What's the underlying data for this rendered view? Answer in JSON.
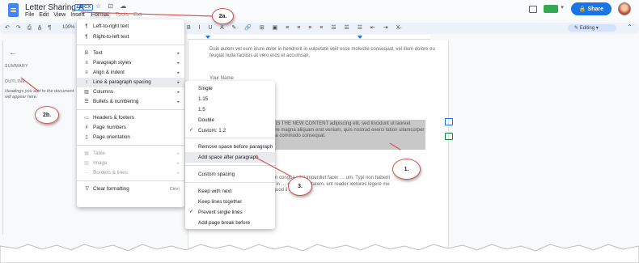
{
  "doc": {
    "title": "Letter Sharing-A",
    "badge": "DOCX",
    "title_icons": "☆ ⊡ ☁"
  },
  "menubar": {
    "items": [
      "File",
      "Edit",
      "View",
      "Insert",
      "Format",
      "Tools",
      "Ext"
    ]
  },
  "share": {
    "label": "Share",
    "icon": "lock-icon"
  },
  "toolbar": {
    "left_icons": "↶ ↷ ⎙ A̲ ¶",
    "zoom": "100%",
    "right_icons": "B I U A ✎ 🔗 ⊞ ▣ ≡ ≡ ≡ ≡ ☰ ☰ ☰ ⇤ ⇥ X̶",
    "editing_label": "Editing"
  },
  "left_panel": {
    "summary": "SUMMARY",
    "outline": "OUTLINE",
    "outline_hint": "Headings you add to the document will appear here."
  },
  "format_menu": {
    "items": [
      {
        "icon": "¶",
        "label": "Left-to-right text",
        "arrow": ""
      },
      {
        "icon": "¶",
        "label": "Right-to-left text",
        "arrow": ""
      },
      {
        "icon": "B",
        "label": "Text",
        "arrow": "▸"
      },
      {
        "icon": "≡",
        "label": "Paragraph styles",
        "arrow": "▸"
      },
      {
        "icon": "≡",
        "label": "Align & indent",
        "arrow": "▸"
      },
      {
        "icon": "↕",
        "label": "Line & paragraph spacing",
        "arrow": "▸"
      },
      {
        "icon": "▥",
        "label": "Columns",
        "arrow": "▸"
      },
      {
        "icon": "☰",
        "label": "Bullets & numbering",
        "arrow": "▸"
      },
      {
        "icon": "▭",
        "label": "Headers & footers",
        "arrow": ""
      },
      {
        "icon": "#",
        "label": "Page numbers",
        "arrow": ""
      },
      {
        "icon": "▯",
        "label": "Page orientation",
        "arrow": ""
      },
      {
        "icon": "▦",
        "label": "Table",
        "arrow": "▸"
      },
      {
        "icon": "▨",
        "label": "Image",
        "arrow": "▸"
      },
      {
        "icon": "─",
        "label": "Borders & lines",
        "arrow": "▸"
      },
      {
        "icon": "T̸",
        "label": "Clear formatting",
        "kbd": "Ctrl+\\"
      }
    ]
  },
  "spacing_submenu": {
    "items": [
      {
        "label": "Single",
        "checked": false
      },
      {
        "label": "1.15",
        "checked": false
      },
      {
        "label": "1.5",
        "checked": false
      },
      {
        "label": "Double",
        "checked": false
      },
      {
        "label": "Custom: 1.2",
        "checked": true
      },
      {
        "label": "Remove space before paragraph",
        "checked": false
      },
      {
        "label": "Add space after paragraph",
        "checked": false
      },
      {
        "label": "Custom spacing",
        "checked": false
      },
      {
        "label": "Keep with next",
        "checked": false
      },
      {
        "label": "Keep lines together",
        "checked": false
      },
      {
        "label": "Prevent single lines",
        "checked": true
      },
      {
        "label": "Add page break before",
        "checked": false
      }
    ]
  },
  "page": {
    "para1": "Duis autem vel eum iriure dolor in hendrerit in vulputate velit esse molestie consequat, vel illum dolore eu feugiat nulla facilisis at vero eros et accumsan.",
    "para2": "Your Name",
    "para3": "HIS IS THE NEW CONTENT adipiscing elit, sed tincidunt ut laoreet dolore magna aliquam erat veniam, quis nostrud exerci tation ullamcorper ex ea commodo consequat.",
    "para4": "option congue nihil imperdiet facer … um. Typi non habent entis in … eorum claritatem. ent reader lectores legere me lius quod ii legunt"
  },
  "callouts": {
    "c1": "1.",
    "c2a": "2a.",
    "c2b": "2b.",
    "c3": "3."
  },
  "colors": {
    "accent": "#1a73e8",
    "annotation": "#d9534f",
    "highlight": "#c8c8c8"
  }
}
